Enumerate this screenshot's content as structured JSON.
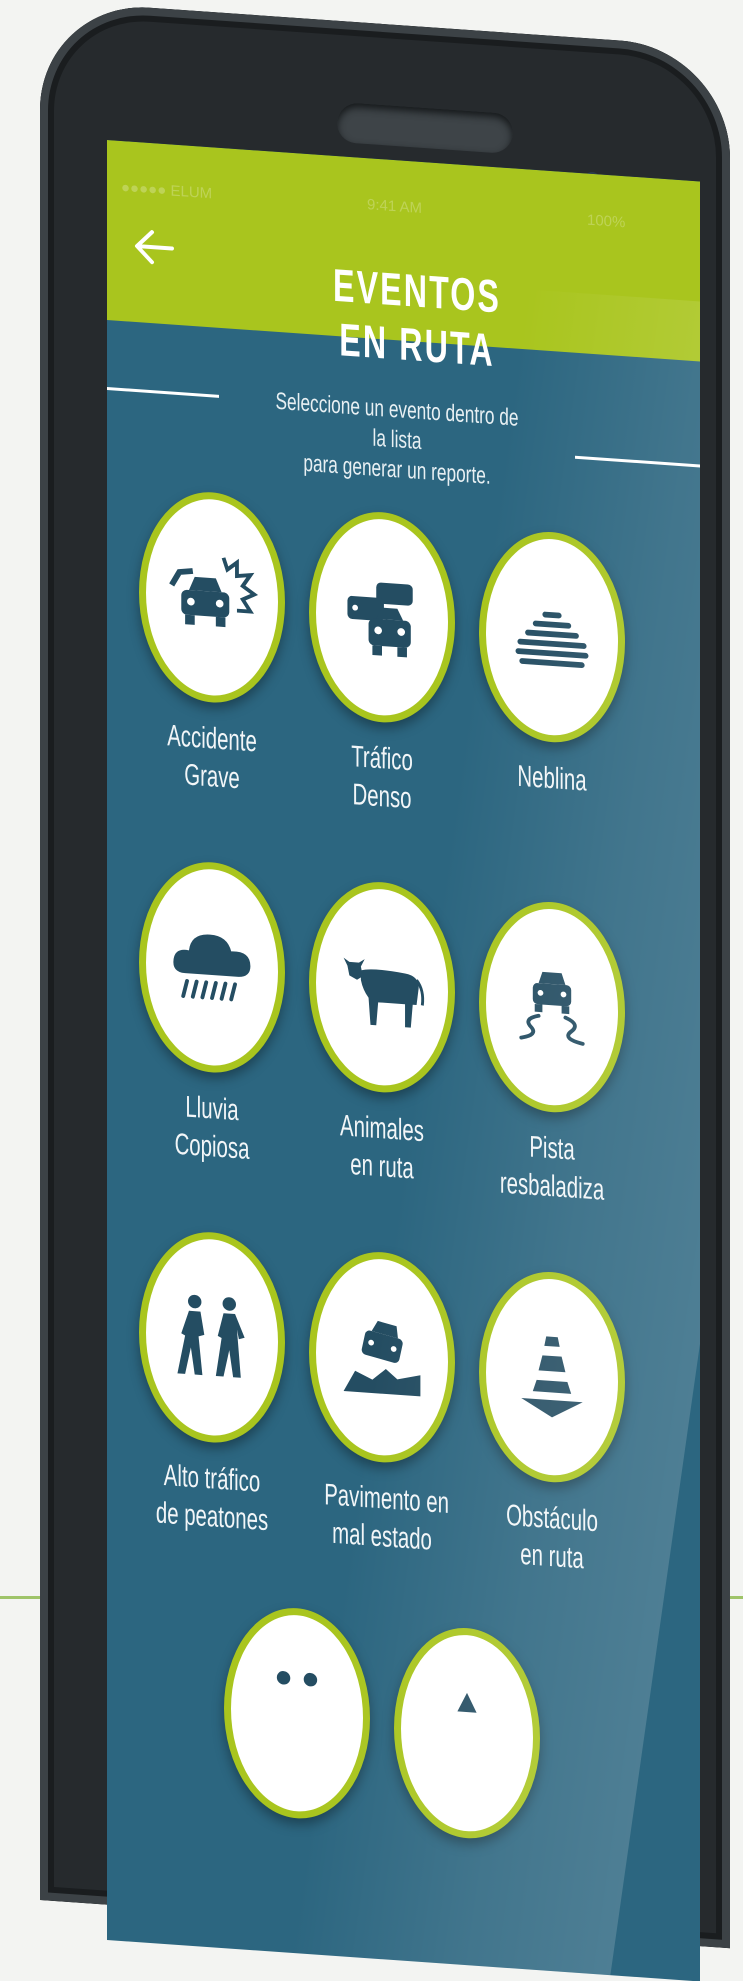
{
  "status_bar": {
    "carrier": "●●●●● ELUM",
    "time": "9:41 AM",
    "battery": "100%"
  },
  "header": {
    "title": "EVENTOS EN RUTA",
    "back_icon": "arrow-left-icon"
  },
  "subtitle": {
    "line1": "Seleccione un evento dentro de la lista",
    "line2": "para generar un reporte."
  },
  "events": [
    {
      "line1": "Accidente",
      "line2": "Grave",
      "icon": "car-crash-icon"
    },
    {
      "line1": "Tráfico",
      "line2": "Denso",
      "icon": "traffic-jam-icon"
    },
    {
      "line1": "Neblina",
      "line2": "",
      "icon": "fog-icon"
    },
    {
      "line1": "Lluvia",
      "line2": "Copiosa",
      "icon": "heavy-rain-icon"
    },
    {
      "line1": "Animales",
      "line2": "en ruta",
      "icon": "cow-icon"
    },
    {
      "line1": "Pista",
      "line2": "resbaladiza",
      "icon": "slippery-road-icon"
    },
    {
      "line1": "Alto tráfico",
      "line2": "de peatones",
      "icon": "pedestrians-icon"
    },
    {
      "line1": "Pavimento en",
      "line2": "mal estado",
      "icon": "damaged-pavement-icon"
    },
    {
      "line1": "Obstáculo",
      "line2": "en ruta",
      "icon": "traffic-cone-icon"
    }
  ],
  "colors": {
    "header": "#a9c51e",
    "screen": "#2c6680",
    "icon": "#244d62",
    "ring": "#a9c51e"
  }
}
